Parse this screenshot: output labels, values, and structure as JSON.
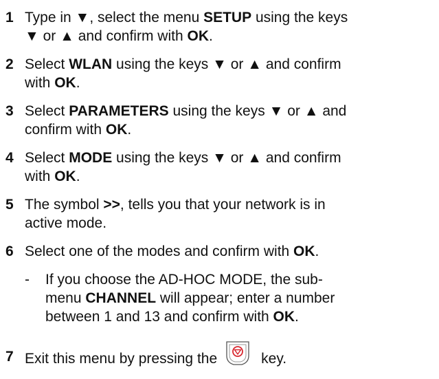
{
  "steps": [
    {
      "number": "1",
      "lines": [
        {
          "pre": "Type in ▼, select the menu ",
          "bold": "SETUP",
          "post": " using the keys"
        },
        {
          "pre": "▼ or ▲ and confirm with ",
          "bold": "OK",
          "post": "."
        }
      ]
    },
    {
      "number": "2",
      "lines": [
        {
          "pre": "Select ",
          "bold": "WLAN",
          "post": " using the keys ▼ or ▲ and confirm"
        },
        {
          "pre": "with ",
          "bold": "OK",
          "post": "."
        }
      ]
    },
    {
      "number": "3",
      "lines": [
        {
          "pre": "Select ",
          "bold": "PARAMETERS",
          "post": " using the keys ▼ or ▲ and"
        },
        {
          "pre": "confirm with ",
          "bold": "OK",
          "post": "."
        }
      ]
    },
    {
      "number": "4",
      "lines": [
        {
          "pre": "Select ",
          "bold": "MODE",
          "post": " using the keys ▼ or ▲ and confirm"
        },
        {
          "pre": "with ",
          "bold": "OK",
          "post": "."
        }
      ]
    },
    {
      "number": "5",
      "lines": [
        {
          "pre": "The symbol ",
          "bold": ">>",
          "post": ", tells you that your network is in"
        },
        {
          "pre": "active mode.",
          "bold": "",
          "post": ""
        }
      ]
    },
    {
      "number": "6",
      "lines": [
        {
          "pre": "Select one of the modes and confirm with ",
          "bold": "OK",
          "post": "."
        }
      ]
    }
  ],
  "sub_item": {
    "dash": "-",
    "lines": [
      {
        "pre": "If you choose the AD-HOC MODE, the sub-",
        "bold": "",
        "post": ""
      },
      {
        "pre": "menu ",
        "bold": "CHANNEL",
        "post": " will appear; enter a number"
      },
      {
        "pre": "between 1 and 13 and confirm with ",
        "bold": "OK",
        "post": "."
      }
    ]
  },
  "step7": {
    "number": "7",
    "pre": "Exit this menu by pressing the",
    "post": "key.",
    "icon": "stop-key-icon"
  }
}
